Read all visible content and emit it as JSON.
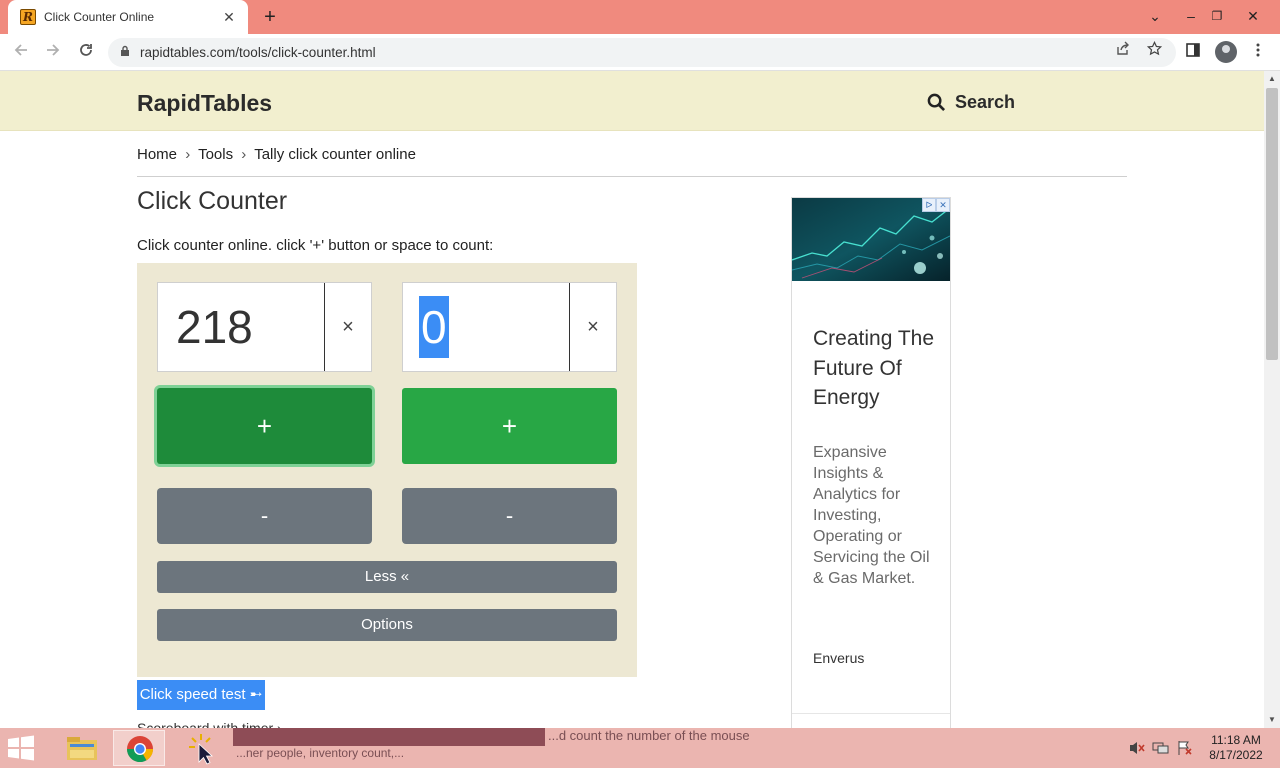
{
  "browser": {
    "tab_title": "Click Counter Online",
    "tab_close": "✕",
    "new_tab": "+",
    "url": "rapidtables.com/tools/click-counter.html",
    "window_controls": {
      "dropdown": "⌄",
      "minimize": "–",
      "restore": "❐",
      "close": "✕"
    }
  },
  "site": {
    "brand": "RapidTables",
    "search_label": "Search"
  },
  "breadcrumb": {
    "home": "Home",
    "sep1": "›",
    "tools": "Tools",
    "sep2": "›",
    "current": "Tally click counter online"
  },
  "main": {
    "title": "Click Counter",
    "intro": "Click counter online. click '+' button or space to count:",
    "counters": [
      {
        "value": "218",
        "clear": "×",
        "plus": "+",
        "minus": "-"
      },
      {
        "value": "0",
        "clear": "×",
        "plus": "+",
        "minus": "-"
      }
    ],
    "less_label": "Less «",
    "options_label": "Options",
    "speed_test_label": "Click speed test ➸",
    "partial_text": "Scoreboard with timer ›"
  },
  "ad": {
    "headline": "Creating The Future Of Energy",
    "body": "Expansive Insights & Analytics for Investing, Operating or Servicing the Oil & Gas Market.",
    "brand": "Enverus",
    "badge_info": "ᐅ",
    "badge_close": "✕"
  },
  "taskbar": {
    "ghost_text_left": "...ner people, inventory count,...",
    "ghost_text_right": "...d count the number of the mouse",
    "clock_time": "11:18 AM",
    "clock_date": "8/17/2022"
  },
  "colors": {
    "tabstrip": "#f08a7e",
    "header_bg": "#f2efcf",
    "panel_bg": "#ede8d3",
    "plus_green": "#28a745",
    "grey_button": "#6c757d",
    "selection_blue": "#3b8df5",
    "taskbar": "#ebb5b0"
  },
  "icons": {
    "back": "arrow-left-icon",
    "forward": "arrow-right-icon",
    "reload": "reload-icon",
    "lock": "lock-icon",
    "share": "share-icon",
    "bookmark": "star-icon",
    "sidepanel": "sidepanel-icon",
    "profile": "profile-icon",
    "menu": "kebab-menu-icon",
    "search": "search-icon"
  }
}
